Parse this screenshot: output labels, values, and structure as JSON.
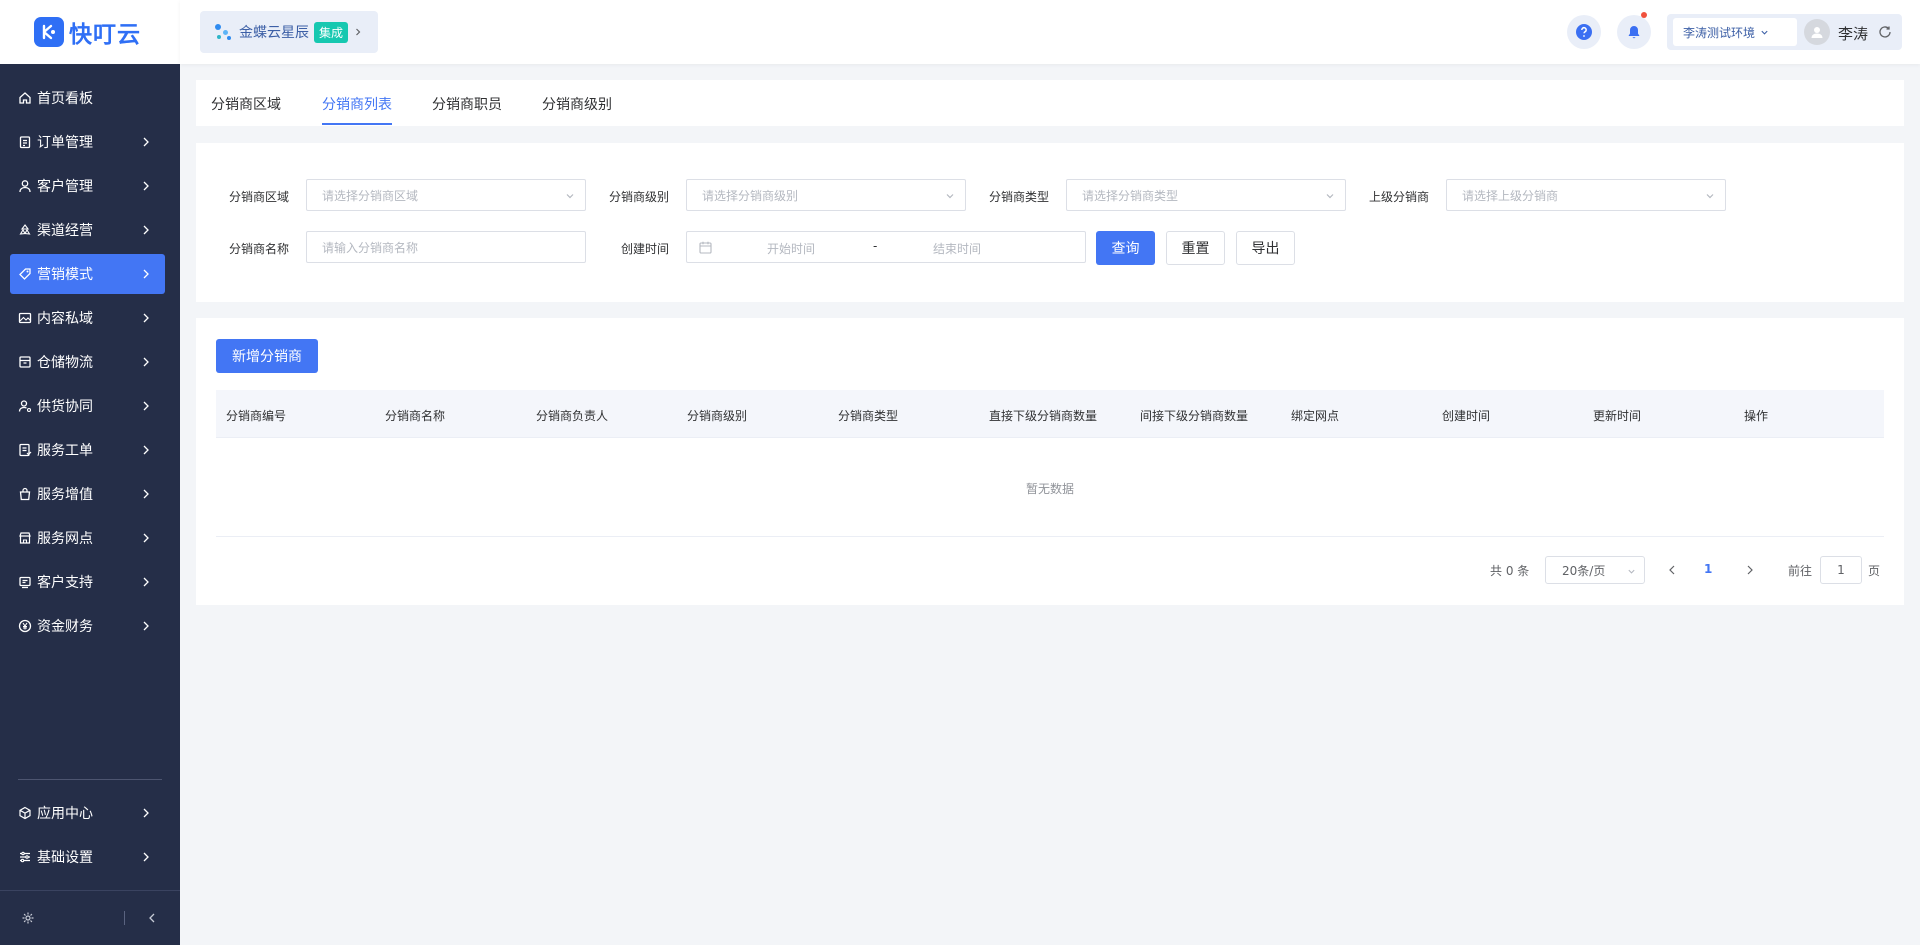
{
  "app": {
    "logo_text": "快叮云"
  },
  "sidebar": {
    "items": [
      {
        "label": "首页看板",
        "icon": "home-icon",
        "has_arrow": false
      },
      {
        "label": "订单管理",
        "icon": "clipboard-icon",
        "has_arrow": true
      },
      {
        "label": "客户管理",
        "icon": "user-icon",
        "has_arrow": true
      },
      {
        "label": "渠道经营",
        "icon": "recycle-icon",
        "has_arrow": true
      },
      {
        "label": "营销模式",
        "icon": "tag-icon",
        "has_arrow": true,
        "active": true
      },
      {
        "label": "内容私域",
        "icon": "image-icon",
        "has_arrow": true
      },
      {
        "label": "仓储物流",
        "icon": "box-icon",
        "has_arrow": true
      },
      {
        "label": "供货协同",
        "icon": "user-cog-icon",
        "has_arrow": true
      },
      {
        "label": "服务工单",
        "icon": "ticket-icon",
        "has_arrow": true
      },
      {
        "label": "服务增值",
        "icon": "bag-icon",
        "has_arrow": true
      },
      {
        "label": "服务网点",
        "icon": "store-icon",
        "has_arrow": true
      },
      {
        "label": "客户支持",
        "icon": "support-icon",
        "has_arrow": true
      },
      {
        "label": "资金财务",
        "icon": "yen-icon",
        "has_arrow": true
      }
    ],
    "bottom_items": [
      {
        "label": "应用中心",
        "icon": "cube-icon"
      },
      {
        "label": "基础设置",
        "icon": "sliders-icon"
      }
    ]
  },
  "header": {
    "brand": "金蝶云星辰",
    "brand_badge": "集成",
    "env_label": "李涛测试环境",
    "user_name": "李涛"
  },
  "tabs": [
    {
      "label": "分销商区域",
      "active": false
    },
    {
      "label": "分销商列表",
      "active": true
    },
    {
      "label": "分销商职员",
      "active": false
    },
    {
      "label": "分销商级别",
      "active": false
    }
  ],
  "filters": {
    "region_label": "分销商区域",
    "region_placeholder": "请选择分销商区域",
    "level_label": "分销商级别",
    "level_placeholder": "请选择分销商级别",
    "type_label": "分销商类型",
    "type_placeholder": "请选择分销商类型",
    "parent_label": "上级分销商",
    "parent_placeholder": "请选择上级分销商",
    "name_label": "分销商名称",
    "name_placeholder": "请输入分销商名称",
    "created_label": "创建时间",
    "start_placeholder": "开始时间",
    "range_sep": "-",
    "end_placeholder": "结束时间",
    "query_button": "查询",
    "reset_button": "重置",
    "export_button": "导出"
  },
  "table": {
    "add_button": "新增分销商",
    "columns": [
      "分销商编号",
      "分销商名称",
      "分销商负责人",
      "分销商级别",
      "分销商类型",
      "直接下级分销商数量",
      "间接下级分销商数量",
      "绑定网点",
      "创建时间",
      "更新时间",
      "操作"
    ],
    "empty_text": "暂无数据"
  },
  "pagination": {
    "total": "共 0 条",
    "page_size": "20条/页",
    "current_page": "1",
    "goto_label": "前往",
    "goto_value": "1",
    "page_unit": "页"
  },
  "colors": {
    "primary": "#4376f4",
    "sidebar_bg": "#252e48",
    "brand_badge": "#16c8b0",
    "notification_dot": "#f0513d"
  }
}
